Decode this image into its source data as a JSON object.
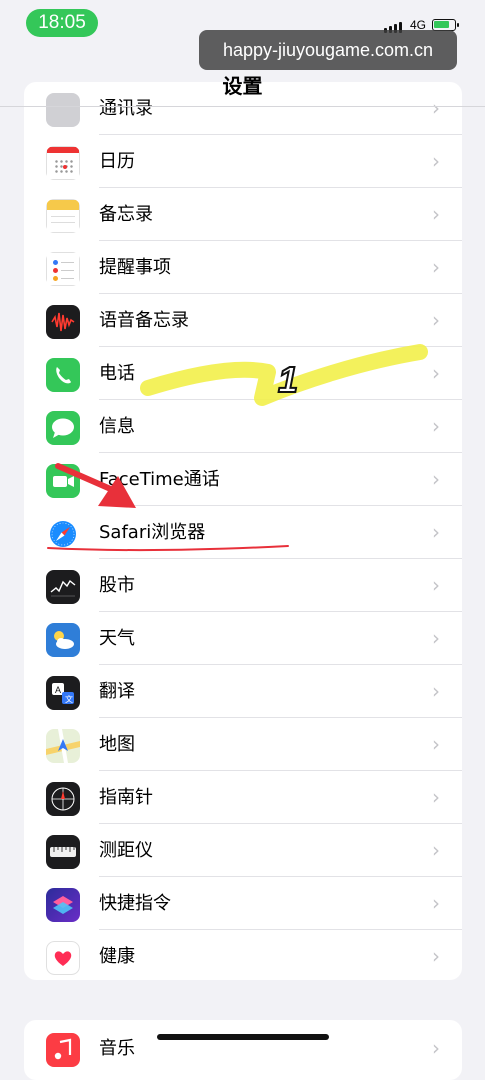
{
  "status_bar": {
    "time": "18:05",
    "network": "4G"
  },
  "watermark": "happy-jiuyougame.com.cn",
  "nav": {
    "title": "设置"
  },
  "settings_items": [
    {
      "label": "通讯录",
      "icon": "contacts-icon"
    },
    {
      "label": "日历",
      "icon": "calendar-icon"
    },
    {
      "label": "备忘录",
      "icon": "notes-icon"
    },
    {
      "label": "提醒事项",
      "icon": "reminders-icon"
    },
    {
      "label": "语音备忘录",
      "icon": "voice-memos-icon"
    },
    {
      "label": "电话",
      "icon": "phone-icon"
    },
    {
      "label": "信息",
      "icon": "messages-icon"
    },
    {
      "label": "FaceTime通话",
      "icon": "facetime-icon"
    },
    {
      "label": "Safari浏览器",
      "icon": "safari-icon"
    },
    {
      "label": "股市",
      "icon": "stocks-icon"
    },
    {
      "label": "天气",
      "icon": "weather-icon"
    },
    {
      "label": "翻译",
      "icon": "translate-icon"
    },
    {
      "label": "地图",
      "icon": "maps-icon"
    },
    {
      "label": "指南针",
      "icon": "compass-icon"
    },
    {
      "label": "测距仪",
      "icon": "measure-icon"
    },
    {
      "label": "快捷指令",
      "icon": "shortcuts-icon"
    },
    {
      "label": "健康",
      "icon": "health-icon"
    }
  ],
  "next_group_items": [
    {
      "label": "音乐",
      "icon": "music-icon"
    }
  ],
  "annotation": {
    "number": "1"
  },
  "colors": {
    "status_pill": "#34c759",
    "highlight": "#f2f04a",
    "arrow": "#e8303a"
  }
}
